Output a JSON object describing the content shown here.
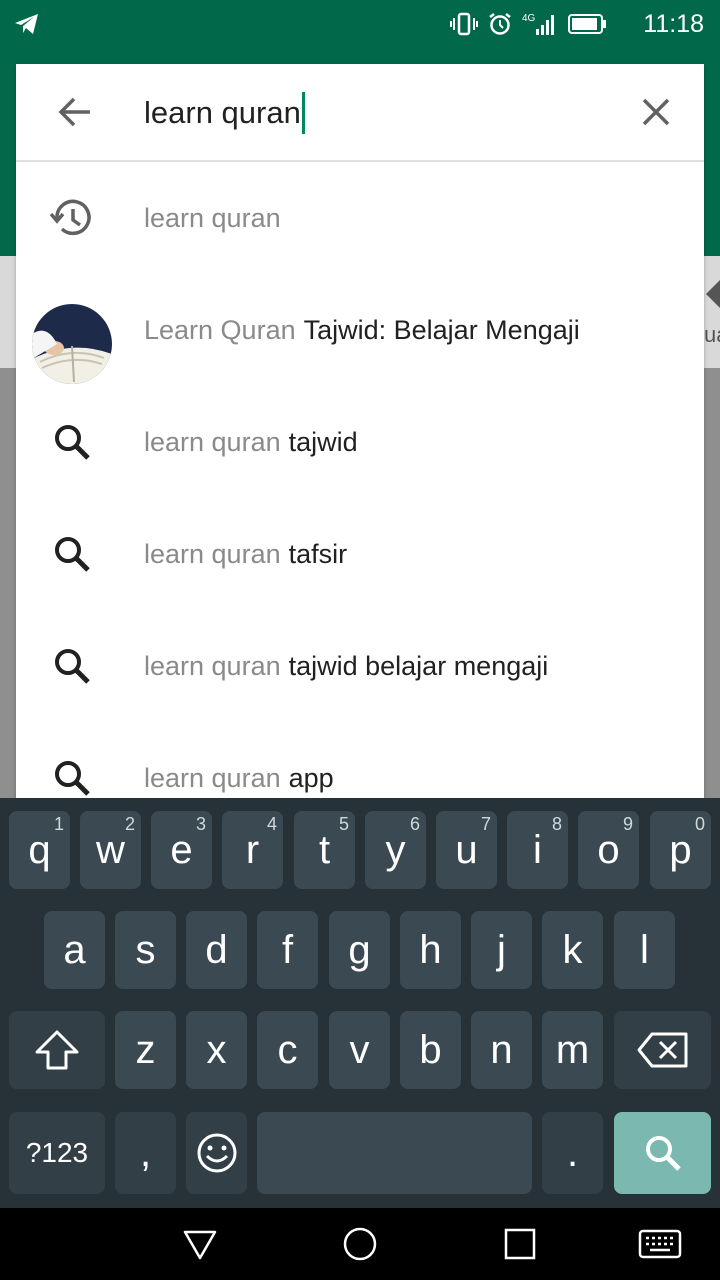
{
  "status_bar": {
    "time": "11:18",
    "network": "4G"
  },
  "search": {
    "query": "learn quran"
  },
  "suggestions": [
    {
      "icon": "history-icon",
      "prefix": "learn quran",
      "suffix": ""
    },
    {
      "icon": "app-avatar",
      "prefix": "Learn Quran",
      "suffix": "Tajwid: Belajar Mengaji"
    },
    {
      "icon": "search-icon",
      "prefix": "learn quran",
      "suffix": "tajwid"
    },
    {
      "icon": "search-icon",
      "prefix": "learn quran",
      "suffix": "tafsir"
    },
    {
      "icon": "search-icon",
      "prefix": "learn quran",
      "suffix": "tajwid belajar mengaji"
    },
    {
      "icon": "search-icon",
      "prefix": "learn quran",
      "suffix": "app"
    }
  ],
  "background": {
    "peek_text": "ua"
  },
  "keyboard": {
    "row1": [
      {
        "key": "q",
        "hint": "1"
      },
      {
        "key": "w",
        "hint": "2"
      },
      {
        "key": "e",
        "hint": "3"
      },
      {
        "key": "r",
        "hint": "4"
      },
      {
        "key": "t",
        "hint": "5"
      },
      {
        "key": "y",
        "hint": "6"
      },
      {
        "key": "u",
        "hint": "7"
      },
      {
        "key": "i",
        "hint": "8"
      },
      {
        "key": "o",
        "hint": "9"
      },
      {
        "key": "p",
        "hint": "0"
      }
    ],
    "row2": [
      "a",
      "s",
      "d",
      "f",
      "g",
      "h",
      "j",
      "k",
      "l"
    ],
    "row3": [
      "z",
      "x",
      "c",
      "v",
      "b",
      "n",
      "m"
    ],
    "symbols_label": "?123",
    "comma": ",",
    "period": "."
  },
  "colors": {
    "header_green": "#01694a",
    "caret": "#01875f",
    "search_key": "#7bb8b0",
    "keyboard_bg": "#263238"
  }
}
